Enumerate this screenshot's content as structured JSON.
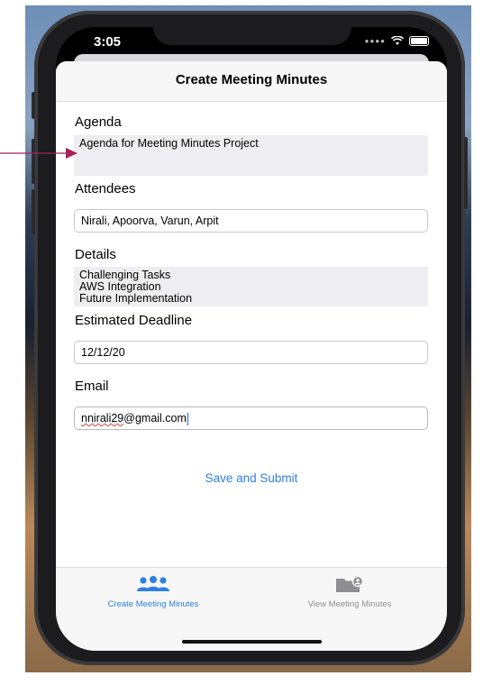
{
  "status_bar": {
    "time": "3:05"
  },
  "nav": {
    "title": "Create Meeting Minutes"
  },
  "form": {
    "agenda_label": "Agenda",
    "agenda_value": "Agenda for Meeting Minutes Project",
    "attendees_label": "Attendees",
    "attendees_value": "Nirali, Apoorva, Varun, Arpit",
    "details_label": "Details",
    "details_lines": [
      "Challenging Tasks",
      "AWS Integration",
      "Future Implementation"
    ],
    "deadline_label": "Estimated Deadline",
    "deadline_value": "12/12/20",
    "email_label": "Email",
    "email_value_underlined": "nnirali29",
    "email_value_rest": "@gmail.com",
    "submit_label": "Save and Submit"
  },
  "tab_bar": {
    "tabs": [
      {
        "label": "Create Meeting Minutes",
        "icon": "people-group-icon",
        "selected": true
      },
      {
        "label": "View Meeting Minutes",
        "icon": "folder-person-icon",
        "selected": false
      }
    ]
  },
  "colors": {
    "accent": "#2f7fe0",
    "annotation_arrow": "#a8205c",
    "text_area_bg": "#eeeef2"
  }
}
